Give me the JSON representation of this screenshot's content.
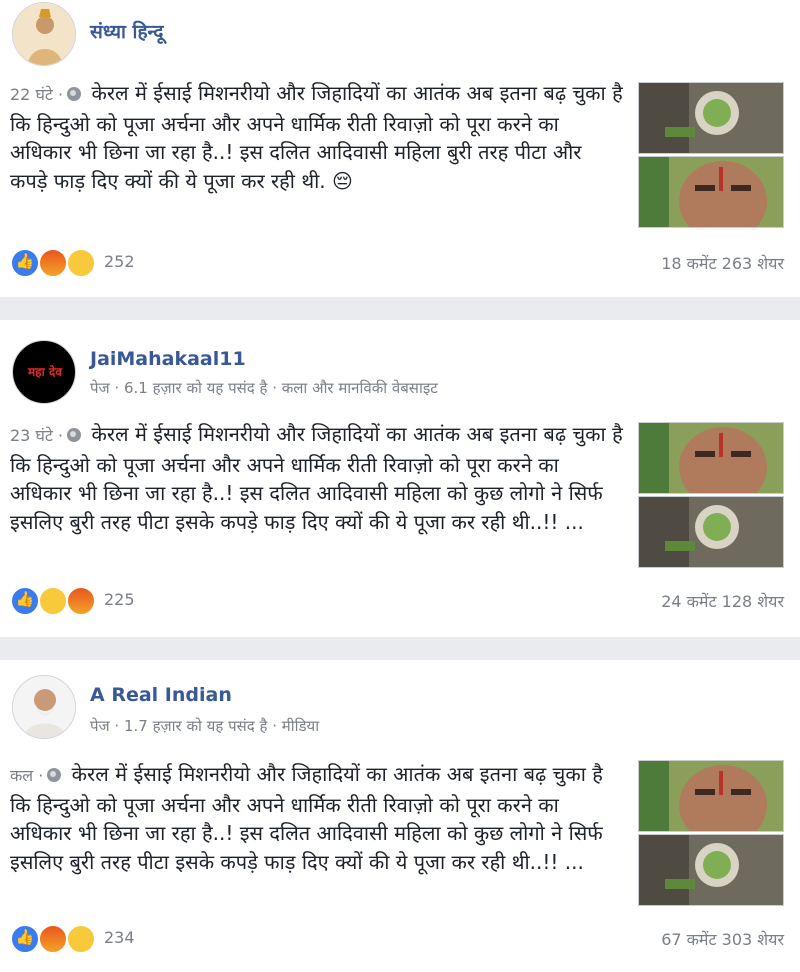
{
  "posts": [
    {
      "author": "संध्या हिन्दू",
      "meta": "",
      "time": "22 घंटे ·",
      "text": "केरल में ईसाई मिशनरीयो और जिहादियों का आतंक अब इतना बढ़ चुका है कि हिन्दुओ को पूजा अर्चना और अपने धार्मिक रीती रिवाज़ो को पूरा करने का अधिकार भी छिना जा रहा है..! इस दलित आदिवासी महिला बुरी तरह पीटा और कपड़े फाड़ दिए क्यों की ये पूजा कर रही थी. 😔",
      "reaction_count": "252",
      "reactions": [
        "like-icon",
        "angry-icon",
        "sad-icon"
      ],
      "comments": "18 कमेंट",
      "shares": "263 शेयर"
    },
    {
      "author": "JaiMahakaal11",
      "meta": "पेज · 6.1 हज़ार को यह पसंद है · कला और मानविकी वेबसाइट",
      "time": "23 घंटे ·",
      "text": "केरल में ईसाई मिशनरीयो और जिहादियों का आतंक अब इतना बढ़ चुका है कि हिन्दुओ को पूजा अर्चना और अपने धार्मिक रीती रिवाज़ो को पूरा करने का अधिकार भी छिना जा रहा है..! इस दलित आदिवासी महिला को कुछ लोगो ने सिर्फ इसलिए बुरी तरह पीटा इसके कपड़े फाड़ दिए क्यों की ये पूजा कर रही थी..!! ...",
      "reaction_count": "225",
      "reactions": [
        "like-icon",
        "sad-icon",
        "angry-icon"
      ],
      "comments": "24 कमेंट",
      "shares": "128 शेयर",
      "avatar_text": "महा देव"
    },
    {
      "author": "A Real Indian",
      "meta": "पेज · 1.7 हज़ार को यह पसंद है · मीडिया",
      "time": "कल ·",
      "text": "केरल में ईसाई मिशनरीयो और जिहादियों का आतंक अब इतना बढ़ चुका है कि हिन्दुओ को पूजा अर्चना और अपने धार्मिक रीती रिवाज़ो को पूरा करने का अधिकार भी छिना जा रहा है..! इस दलित आदिवासी महिला को कुछ लोगो ने सिर्फ इसलिए बुरी तरह पीटा इसके कपड़े फाड़ दिए क्यों की ये पूजा कर रही थी..!! ...",
      "reaction_count": "234",
      "reactions": [
        "like-icon",
        "angry-icon",
        "sad-icon"
      ],
      "comments": "67 कमेंट",
      "shares": "303 शेयर"
    }
  ],
  "colors": {
    "link": "#385898",
    "like": "#3b7bf0",
    "angry": "#e9561e",
    "sad": "#f7c93b",
    "divider": "#e9ebee"
  }
}
